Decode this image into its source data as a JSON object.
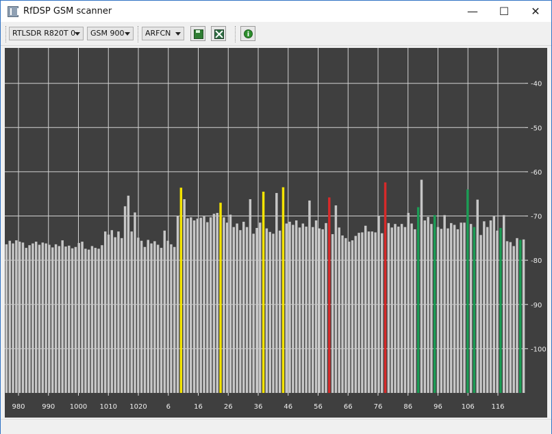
{
  "window": {
    "title": "RfDSP GSM scanner",
    "controls": {
      "minimize": "—",
      "maximize": "☐",
      "close": "✕"
    }
  },
  "toolbar": {
    "device": "RTLSDR R820T 0",
    "band": "GSM 900",
    "mode": "ARFCN",
    "icons": [
      "save-icon",
      "clear-icon",
      "info-icon"
    ]
  },
  "chart_data": {
    "type": "bar",
    "x_labels": [
      "980",
      "990",
      "1000",
      "1010",
      "1020",
      "6",
      "16",
      "26",
      "36",
      "46",
      "56",
      "66",
      "76",
      "86",
      "96",
      "106",
      "116"
    ],
    "y_ticks": [
      -40,
      -50,
      -60,
      -70,
      -80,
      -90,
      -100
    ],
    "ylim": [
      -110,
      -32
    ],
    "colors": {
      "background": "#3f3f3f",
      "grid": "#d4d4d4",
      "gray": "#c7c7c7",
      "yellow": "#f4e400",
      "red": "#d62a2a",
      "green": "#1c9c55"
    },
    "values": [
      -76.4,
      -75.6,
      -76.2,
      -75.5,
      -75.8,
      -76.0,
      -77.2,
      -76.6,
      -76.2,
      -75.8,
      -76.5,
      -76.0,
      -76.2,
      -76.5,
      -77.1,
      -76.4,
      -76.8,
      -75.5,
      -76.9,
      -76.7,
      -77.3,
      -77.0,
      -76.1,
      -75.8,
      -77.4,
      -77.6,
      -76.8,
      -77.2,
      -77.4,
      -76.6,
      -73.5,
      -74.2,
      -73.2,
      -74.8,
      -73.5,
      -75.0,
      -67.8,
      -65.4,
      -73.5,
      -69.2,
      -74.9,
      -75.6,
      -77.0,
      -75.4,
      -76.2,
      -75.7,
      -76.5,
      -77.2,
      -73.3,
      -75.6,
      -76.4,
      -77.0,
      -70.0,
      -63.6,
      -66.2,
      -70.5,
      -70.3,
      -71.0,
      -70.6,
      -70.4,
      -70.1,
      -71.4,
      -70.3,
      -69.5,
      -69.3,
      -67.0,
      -70.3,
      -71.5,
      -69.7,
      -72.5,
      -71.7,
      -73.2,
      -71.3,
      -72.5,
      -66.2,
      -74.0,
      -72.7,
      -71.5,
      -64.5,
      -72.8,
      -73.6,
      -74.0,
      -64.8,
      -73.3,
      -63.5,
      -71.7,
      -71.3,
      -72.0,
      -71.0,
      -72.6,
      -71.7,
      -72.4,
      -66.5,
      -72.5,
      -71.0,
      -72.8,
      -73.0,
      -71.6,
      -65.8,
      -74.1,
      -67.6,
      -72.6,
      -74.4,
      -75.0,
      -75.8,
      -75.5,
      -74.5,
      -73.8,
      -73.7,
      -72.2,
      -73.5,
      -73.5,
      -73.7,
      -70.0,
      -73.9,
      -62.4,
      -71.6,
      -72.6,
      -71.8,
      -72.4,
      -71.8,
      -72.5,
      -69.3,
      -71.7,
      -73.0,
      -68.0,
      -61.8,
      -71.0,
      -70.2,
      -71.8,
      -69.8,
      -72.5,
      -72.9,
      -69.8,
      -72.8,
      -71.6,
      -72.0,
      -73.0,
      -71.5,
      -71.5,
      -64.0,
      -71.8,
      -72.5,
      -66.3,
      -74.3,
      -71.2,
      -72.5,
      -71.0,
      -70.1,
      -73.3,
      -72.7,
      -69.8,
      -75.7,
      -75.9,
      -76.8,
      -75.0,
      -75.4,
      -75.3
    ],
    "highlights": [
      {
        "index": 53,
        "color": "yellow"
      },
      {
        "index": 65,
        "color": "yellow"
      },
      {
        "index": 78,
        "color": "yellow"
      },
      {
        "index": 84,
        "color": "yellow"
      },
      {
        "index": 98,
        "color": "red"
      },
      {
        "index": 115,
        "color": "red"
      },
      {
        "index": 125,
        "color": "green"
      },
      {
        "index": 130,
        "color": "green"
      },
      {
        "index": 140,
        "color": "green"
      },
      {
        "index": 142,
        "color": "green"
      },
      {
        "index": 150,
        "color": "green"
      },
      {
        "index": 156,
        "color": "green"
      }
    ]
  }
}
